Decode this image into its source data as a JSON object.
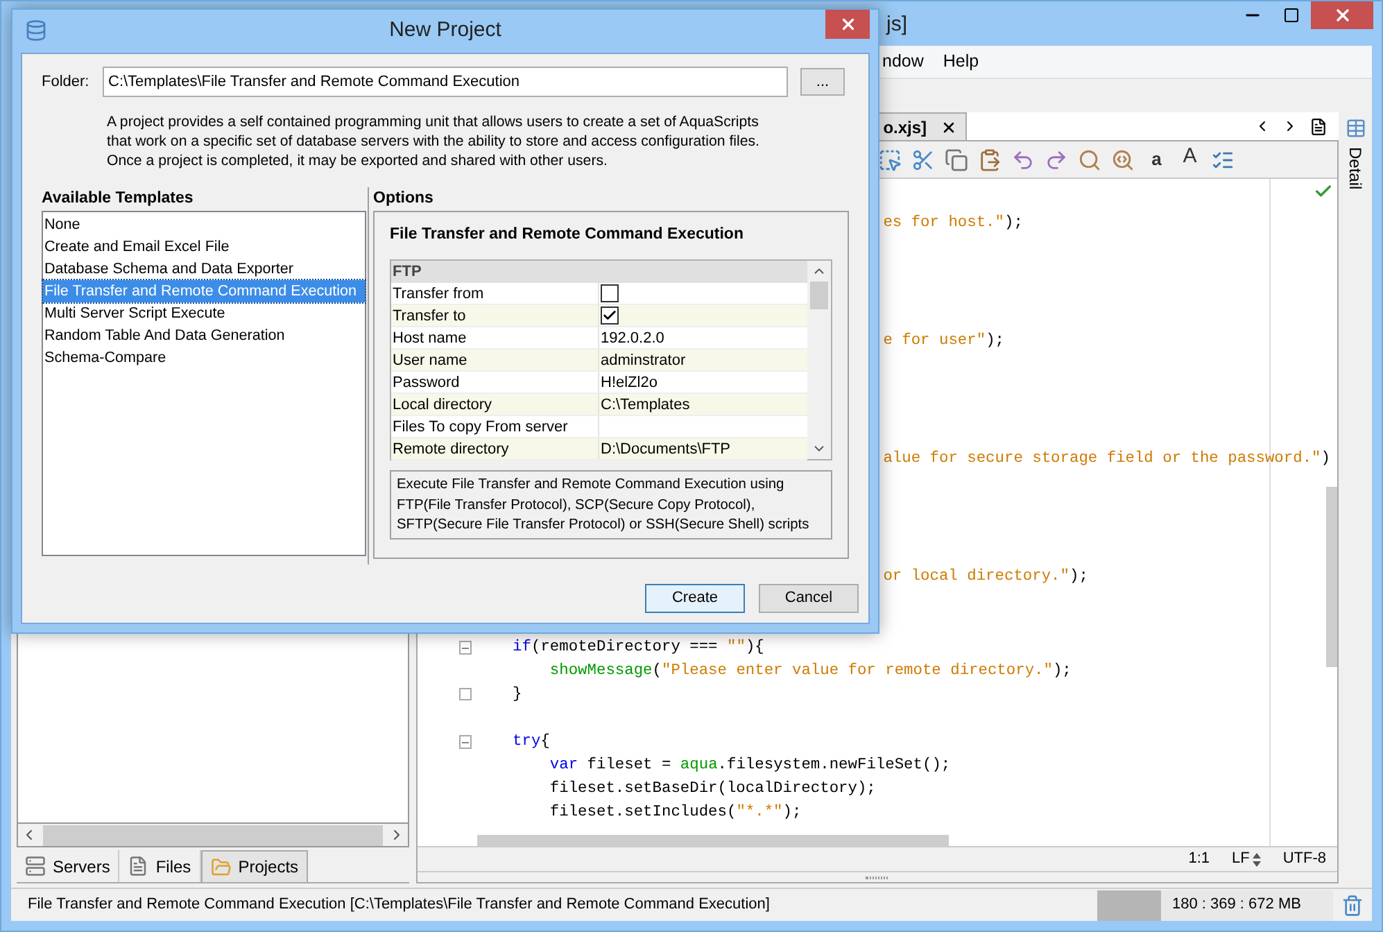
{
  "main_window": {
    "title": "js]",
    "menu": [
      "ndow",
      "Help"
    ]
  },
  "editor": {
    "tab": "o.xjs]",
    "toolbar": [
      {
        "kind": "select"
      },
      {
        "kind": "cut"
      },
      {
        "kind": "copy"
      },
      {
        "kind": "paste"
      },
      {
        "kind": "undo"
      },
      {
        "kind": "redo"
      },
      {
        "kind": "find"
      },
      {
        "kind": "replace"
      },
      {
        "kind": "shrink",
        "label": "a"
      },
      {
        "kind": "grow",
        "label": "A"
      },
      {
        "kind": "tasks"
      }
    ],
    "lines": [
      {
        "kind": "blank"
      },
      {
        "kind": "partial",
        "tokens": [
          {
            "t": "es for host.\"",
            "kind": "str"
          },
          {
            "t": ");",
            "kind": "plain"
          }
        ]
      },
      {
        "kind": "blank"
      },
      {
        "kind": "blank"
      },
      {
        "kind": "blank"
      },
      {
        "kind": "blank"
      },
      {
        "kind": "partial",
        "tokens": [
          {
            "t": "e for user\"",
            "kind": "str"
          },
          {
            "t": ");",
            "kind": "plain"
          }
        ]
      },
      {
        "kind": "blank"
      },
      {
        "kind": "blank"
      },
      {
        "kind": "blank"
      },
      {
        "kind": "blank"
      },
      {
        "kind": "partial",
        "tokens": [
          {
            "t": "alue for secure storage field or the password.\"",
            "kind": "str"
          },
          {
            "t": ")",
            "kind": "plain"
          }
        ]
      },
      {
        "kind": "blank"
      },
      {
        "kind": "blank"
      },
      {
        "kind": "blank"
      },
      {
        "kind": "blank"
      },
      {
        "kind": "partial",
        "tokens": [
          {
            "t": "or local directory.\"",
            "kind": "str"
          },
          {
            "t": ");",
            "kind": "plain"
          }
        ]
      },
      {
        "kind": "blank"
      },
      {
        "kind": "blank"
      },
      {
        "kind": "fold_start",
        "tokens": [
          {
            "t": "    if",
            "kind": "kw"
          },
          {
            "t": "(remoteDirectory === ",
            "kind": "plain"
          },
          {
            "t": "\"\"",
            "kind": "str"
          },
          {
            "t": "){",
            "kind": "plain"
          }
        ]
      },
      {
        "kind": "code",
        "tokens": [
          {
            "t": "        showMessage",
            "kind": "fn"
          },
          {
            "t": "(",
            "kind": "plain"
          },
          {
            "t": "\"Please enter value for remote directory.\"",
            "kind": "str"
          },
          {
            "t": ");",
            "kind": "plain"
          }
        ]
      },
      {
        "kind": "fold_end",
        "tokens": [
          {
            "t": "    }",
            "kind": "plain"
          }
        ]
      },
      {
        "kind": "blank"
      },
      {
        "kind": "fold_start",
        "tokens": [
          {
            "t": "    try",
            "kind": "kw"
          },
          {
            "t": "{",
            "kind": "plain"
          }
        ]
      },
      {
        "kind": "code",
        "tokens": [
          {
            "t": "        var",
            "kind": "kw"
          },
          {
            "t": " fileset = ",
            "kind": "plain"
          },
          {
            "t": "aqua",
            "kind": "fn"
          },
          {
            "t": ".filesystem.newFileSet();",
            "kind": "plain"
          }
        ]
      },
      {
        "kind": "code",
        "tokens": [
          {
            "t": "        fileset.setBaseDir(localDirectory);",
            "kind": "plain"
          }
        ]
      },
      {
        "kind": "code",
        "tokens": [
          {
            "t": "        fileset.setIncludes(",
            "kind": "plain"
          },
          {
            "t": "\"*.*\"",
            "kind": "str"
          },
          {
            "t": ");",
            "kind": "plain"
          }
        ]
      }
    ],
    "status": {
      "position": "1:1",
      "line_ending": "LF",
      "encoding": "UTF-8"
    }
  },
  "side_panel": {
    "label": "Detail"
  },
  "left_panel": {
    "tabs": [
      {
        "label": "Servers",
        "kind": "servers",
        "selected": false
      },
      {
        "label": "Files",
        "kind": "files",
        "selected": false
      },
      {
        "label": "Projects",
        "kind": "projects",
        "selected": true
      }
    ]
  },
  "status_bar": {
    "text": "File Transfer and Remote Command Execution [C:\\Templates\\File Transfer and Remote Command Execution]",
    "memory": "180 : 369 : 672 MB",
    "level": 0.27
  },
  "dialog": {
    "title": "New Project",
    "folder_label": "Folder:",
    "folder_value": "C:\\Templates\\File Transfer and Remote Command Execution",
    "browse": "...",
    "description": "A project provides a self contained programming unit that allows users to create a set of AquaScripts\nthat work on a specific set of database servers with the ability to store and access configuration files.\n Once a project is completed, it may be exported and shared with other users.",
    "templates_heading": "Available Templates",
    "templates": [
      {
        "label": "None",
        "selected": false
      },
      {
        "label": "Create and Email Excel File",
        "selected": false
      },
      {
        "label": "Database Schema and Data Exporter",
        "selected": false
      },
      {
        "label": "File Transfer and Remote Command Execution",
        "selected": true
      },
      {
        "label": "Multi Server Script Execute",
        "selected": false
      },
      {
        "label": "Random Table And Data Generation",
        "selected": false
      },
      {
        "label": "Schema-Compare",
        "selected": false
      }
    ],
    "options_heading": "Options",
    "options_title": "File Transfer and Remote Command Execution",
    "group": "FTP",
    "properties": [
      {
        "name": "Transfer from",
        "kind": "checkbox",
        "checked": false
      },
      {
        "name": "Transfer to",
        "kind": "checkbox",
        "checked": true
      },
      {
        "name": "Host name",
        "kind": "text",
        "value": "192.0.2.0"
      },
      {
        "name": "User name",
        "kind": "text",
        "value": "adminstrator"
      },
      {
        "name": "Password",
        "kind": "text",
        "value": "H!elZl2o"
      },
      {
        "name": "Local directory",
        "kind": "text",
        "value": "C:\\Templates"
      },
      {
        "name": "Files To copy From server",
        "kind": "text"
      },
      {
        "name": "Remote directory",
        "kind": "text",
        "value": "D:\\Documents\\FTP"
      }
    ],
    "info": "Execute File Transfer and Remote Command Execution using\nFTP(File Transfer Protocol), SCP(Secure Copy Protocol),\nSFTP(Secure File Transfer Protocol) or SSH(Secure Shell) scripts",
    "buttons": [
      {
        "label": "Create",
        "kind": "default"
      },
      {
        "label": "Cancel",
        "kind": "normal"
      }
    ]
  }
}
